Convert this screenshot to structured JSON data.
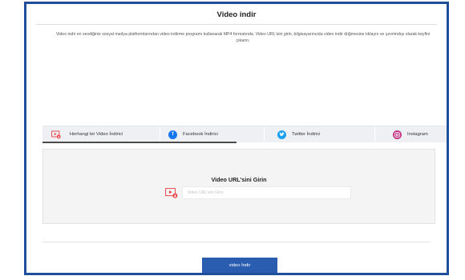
{
  "page": {
    "title": "Video indir",
    "description": "Video indir en sevdiğiniz sosyal medya platformlarından video indirme programı kullanarak MP4 formatında. Video URL'sini girin, bilgisayarınızda video indir düğmesine tıklayın ve çevrimdışı olarak keyfini çıkarın."
  },
  "tabs": [
    {
      "label": "Herhangi bir Video İndirici",
      "icon": "video-download-icon",
      "color": "#e8474a",
      "active": true
    },
    {
      "label": "Facebook İndirici",
      "icon": "facebook-icon",
      "color": "#1877f2",
      "active": false
    },
    {
      "label": "Twitter İndirici",
      "icon": "twitter-icon",
      "color": "#1da1f2",
      "active": false
    },
    {
      "label": "Instagram",
      "icon": "instagram-icon",
      "color": "#c13584",
      "active": false
    }
  ],
  "form": {
    "heading": "Video URL'sini Girin",
    "placeholder": "Video URL'sini Girin",
    "value": ""
  },
  "actions": {
    "download_label": "video İndir"
  },
  "colors": {
    "frame_border": "#1f4e9a",
    "button": "#2a5db0",
    "red_accent": "#e8474a"
  }
}
